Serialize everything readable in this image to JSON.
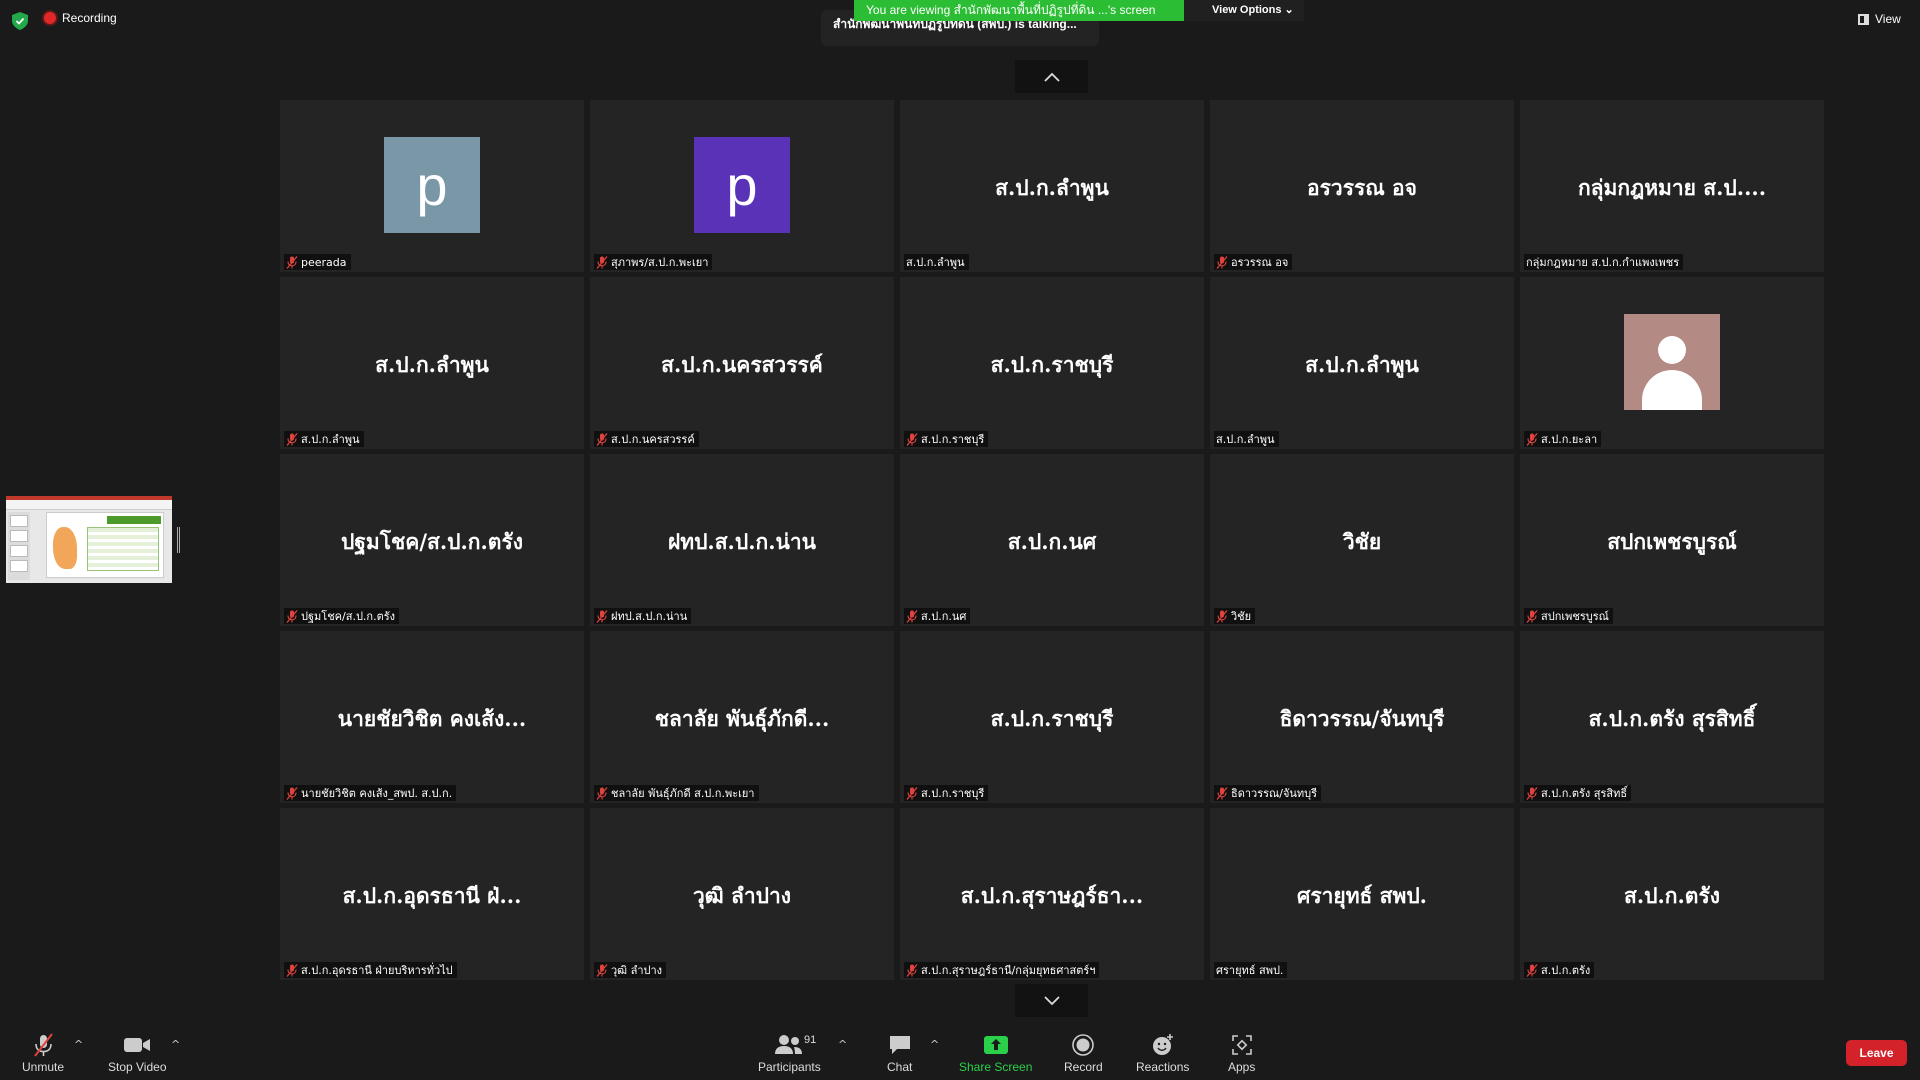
{
  "top": {
    "recording_label": "Recording",
    "talking_text": "สำนักพัฒนาพื้นที่ปฏิรูปที่ดิน (สพป.) is talking...",
    "viewing_text": "You are viewing สำนักพัฒนาพื้นที่ปฏิรูปที่ดิน ...'s screen",
    "view_options_label": "View Options",
    "view_label": "View"
  },
  "tiles": [
    {
      "title": "",
      "avatar": "p",
      "avatar_color": "#7a97a8",
      "label": "peerada",
      "muted": true
    },
    {
      "title": "",
      "avatar": "p",
      "avatar_color": "#5932b8",
      "label": "สุภาพร/ส.ป.ก.พะเยา",
      "muted": true
    },
    {
      "title": "ส.ป.ก.ลำพูน",
      "avatar": "",
      "label": "ส.ป.ก.ลำพูน",
      "muted": false
    },
    {
      "title": "อรวรรณ อจ",
      "avatar": "",
      "label": "อรวรรณ อจ",
      "muted": true
    },
    {
      "title": "กลุ่มกฎหมาย ส.ป....",
      "avatar": "",
      "label": "กลุ่มกฎหมาย ส.ป.ก.กำแพงเพชร",
      "muted": false
    },
    {
      "title": "ส.ป.ก.ลำพูน",
      "avatar": "",
      "label": "ส.ป.ก.ลำพูน",
      "muted": true
    },
    {
      "title": "ส.ป.ก.นครสวรรค์",
      "avatar": "",
      "label": "ส.ป.ก.นครสวรรค์",
      "muted": true
    },
    {
      "title": "ส.ป.ก.ราชบุรี",
      "avatar": "",
      "label": "ส.ป.ก.ราชบุรี",
      "muted": true
    },
    {
      "title": "ส.ป.ก.ลำพูน",
      "avatar": "",
      "label": "ส.ป.ก.ลำพูน",
      "muted": false
    },
    {
      "title": "",
      "avatar": "photo",
      "label": "ส.ป.ก.ยะลา",
      "muted": true
    },
    {
      "title": "ปฐมโชค/ส.ป.ก.ตรัง",
      "avatar": "",
      "label": "ปฐมโชค/ส.ป.ก.ตรัง",
      "muted": true
    },
    {
      "title": "ฝทป.ส.ป.ก.น่าน",
      "avatar": "",
      "label": "ฝทป.ส.ป.ก.น่าน",
      "muted": true
    },
    {
      "title": "ส.ป.ก.นศ",
      "avatar": "",
      "label": "ส.ป.ก.นศ",
      "muted": true
    },
    {
      "title": "วิชัย",
      "avatar": "",
      "label": "วิชัย",
      "muted": true
    },
    {
      "title": "สปกเพชรบูรณ์",
      "avatar": "",
      "label": "สปกเพชรบูรณ์",
      "muted": true
    },
    {
      "title": "นายชัยวิชิต คงเส้ง...",
      "avatar": "",
      "label": "นายชัยวิชิต คงเส้ง_สพป. ส.ป.ก.",
      "muted": true
    },
    {
      "title": "ชลาลัย  พันธุ์ภักดี...",
      "avatar": "",
      "label": "ชลาลัย  พันธุ์ภักดี ส.ป.ก.พะเยา",
      "muted": true
    },
    {
      "title": "ส.ป.ก.ราชบุรี",
      "avatar": "",
      "label": "ส.ป.ก.ราชบุรี",
      "muted": true
    },
    {
      "title": "ธิดาวรรณ/จันทบุรี",
      "avatar": "",
      "label": "ธิดาวรรณ/จันทบุรี",
      "muted": true
    },
    {
      "title": "ส.ป.ก.ตรัง สุรสิทธิ์",
      "avatar": "",
      "label": "ส.ป.ก.ตรัง สุรสิทธิ์",
      "muted": true
    },
    {
      "title": "ส.ป.ก.อุดรธานี ฝ่...",
      "avatar": "",
      "label": "ส.ป.ก.อุดรธานี ฝ่ายบริหารทั่วไป",
      "muted": true
    },
    {
      "title": "วุฒิ ลำปาง",
      "avatar": "",
      "label": "วุฒิ ลำปาง",
      "muted": true
    },
    {
      "title": "ส.ป.ก.สุราษฎร์ธา...",
      "avatar": "",
      "label": "ส.ป.ก.สุราษฎร์ธานี/กลุ่มยุทธศาสตร์ฯ",
      "muted": true
    },
    {
      "title": "ศรายุทธ์ สพป.",
      "avatar": "",
      "label": "ศรายุทธ์ สพป.",
      "muted": false
    },
    {
      "title": "ส.ป.ก.ตรัง",
      "avatar": "",
      "label": "ส.ป.ก.ตรัง",
      "muted": true
    }
  ],
  "toolbar": {
    "unmute": "Unmute",
    "stop_video": "Stop Video",
    "participants": "Participants",
    "participants_count": "91",
    "chat": "Chat",
    "share_screen": "Share Screen",
    "record": "Record",
    "reactions": "Reactions",
    "apps": "Apps",
    "leave": "Leave"
  },
  "colors": {
    "share_green": "#2bd04a",
    "leave_red": "#d3222a",
    "muted_red": "#e0433e",
    "viewing_green": "#2bbd34"
  }
}
